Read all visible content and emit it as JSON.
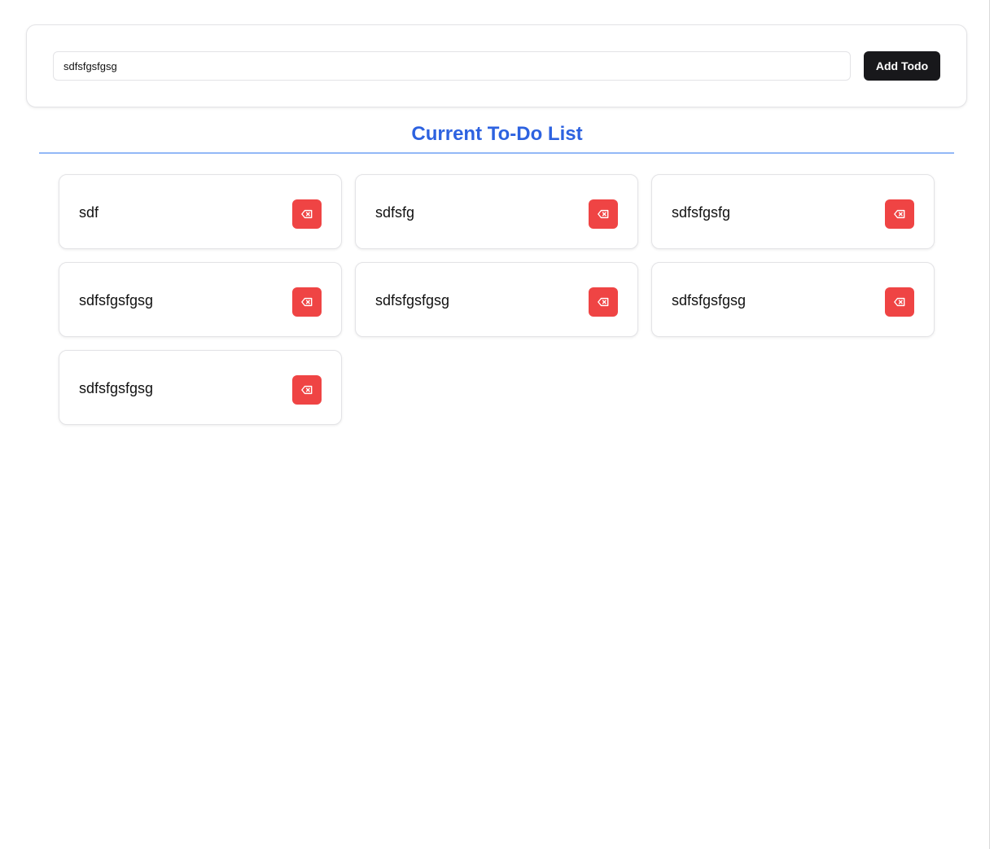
{
  "form": {
    "input_value": "sdfsfgsfgsg",
    "add_button_label": "Add Todo"
  },
  "list": {
    "title": "Current To-Do List",
    "items": [
      {
        "text": "sdf",
        "delete_icon": "backspace-x-icon"
      },
      {
        "text": "sdfsfg",
        "delete_icon": "backspace-x-icon"
      },
      {
        "text": "sdfsfgsfg",
        "delete_icon": "backspace-x-icon"
      },
      {
        "text": "sdfsfgsfgsg",
        "delete_icon": "backspace-x-icon"
      },
      {
        "text": "sdfsfgsfgsg",
        "delete_icon": "backspace-x-icon"
      },
      {
        "text": "sdfsfgsfgsg",
        "delete_icon": "backspace-x-icon"
      },
      {
        "text": "sdfsfgsfgsg",
        "delete_icon": "backspace-x-icon"
      }
    ]
  },
  "colors": {
    "title": "#2d62e0",
    "divider": "#93b8f7",
    "add_button": "#18181b",
    "delete_button": "#ef4444"
  }
}
